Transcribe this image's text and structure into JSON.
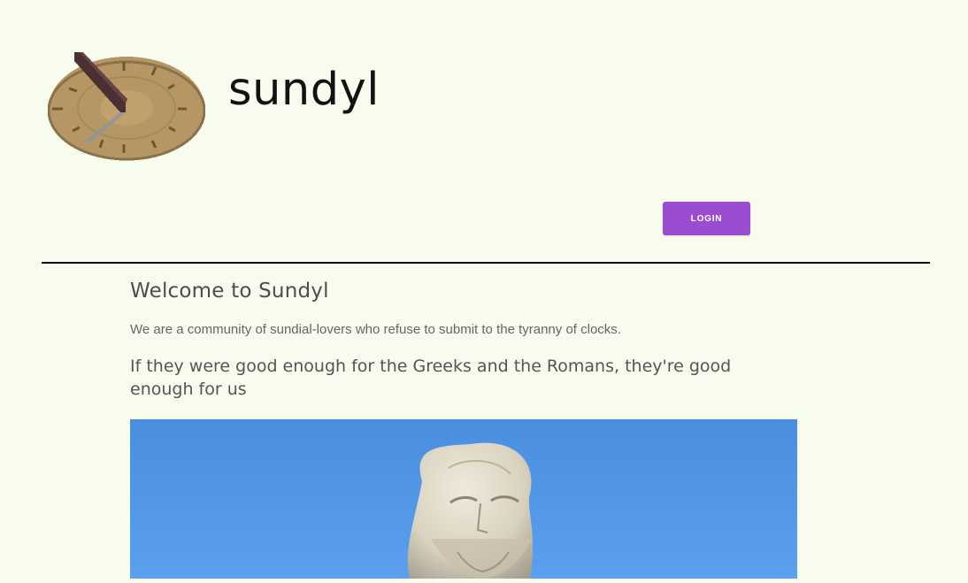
{
  "header": {
    "brand_name": "sundyl",
    "logo_icon": "sundial-icon",
    "login_label": "LOGIN",
    "login_color": "#9a4dd1"
  },
  "main": {
    "title": "Welcome to Sundyl",
    "intro": "We are a community of sundial-lovers who refuse to submit to the tyranny of clocks.",
    "subtitle": "If they were good enough for the Greeks and the Romans, they're good enough for us",
    "hero_image": "greek-philosopher-statue-image"
  },
  "colors": {
    "page_background": "#f8fcef",
    "title_text": "#4e4e4e",
    "body_text": "#666666",
    "divider": "#000000"
  }
}
